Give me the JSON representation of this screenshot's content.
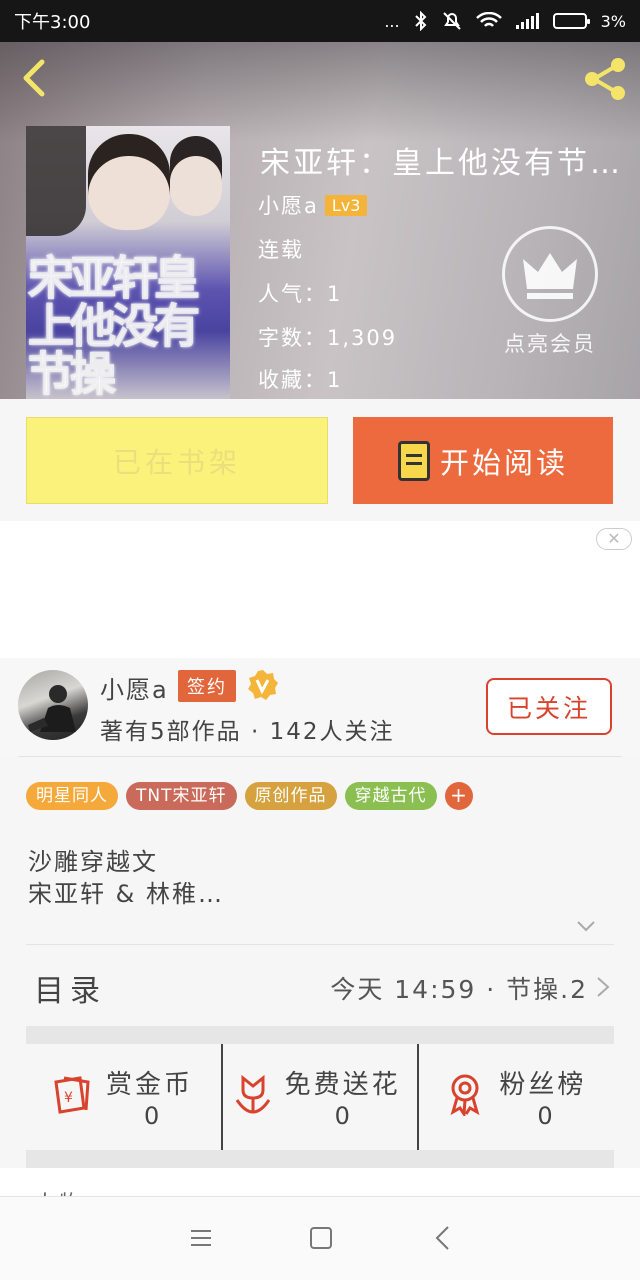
{
  "status_bar": {
    "time": "下午3:00",
    "dots": "...",
    "battery_text": "3%"
  },
  "header": {
    "book_title": "宋亚轩：皇上他没有节…",
    "author": "小愿a",
    "level": "Lv3",
    "status": "连载",
    "popularity": "人气：1",
    "word_count": "字数：1,309",
    "favorites": "收藏：1",
    "vip_label": "点亮会员",
    "cover_text": "宋亚轩皇上他没有节操"
  },
  "actions": {
    "shelf_label": "已在书架",
    "read_label": "开始阅读"
  },
  "ad": {
    "close_glyph": "✕"
  },
  "author": {
    "name": "小愿a",
    "sign_badge": "签约",
    "stats": "著有5部作品 · 142人关注",
    "follow_label": "已关注"
  },
  "tags": [
    {
      "label": "明星同人",
      "color": "#f4a93a"
    },
    {
      "label": "TNT宋亚轩",
      "color": "#c96a5a"
    },
    {
      "label": "原创作品",
      "color": "#d6a23f"
    },
    {
      "label": "穿越古代",
      "color": "#8bbf52"
    }
  ],
  "tag_add": "+",
  "intro": {
    "line1": "沙雕穿越文",
    "line2": "宋亚轩 & 林稚…"
  },
  "toc": {
    "title": "目录",
    "latest": "今天 14:59 · 节操.2"
  },
  "stats": {
    "reward": {
      "label": "赏金币",
      "value": "0"
    },
    "flowers": {
      "label": "免费送花",
      "value": "0"
    },
    "fans": {
      "label": "粉丝榜",
      "value": "0"
    }
  },
  "bottom_peek": "人物…",
  "colors": {
    "accent_orange": "#ec6a3d",
    "shelf_yellow": "#fbf27c",
    "follow_red": "#d9432d",
    "icon_red": "#d9432d"
  }
}
